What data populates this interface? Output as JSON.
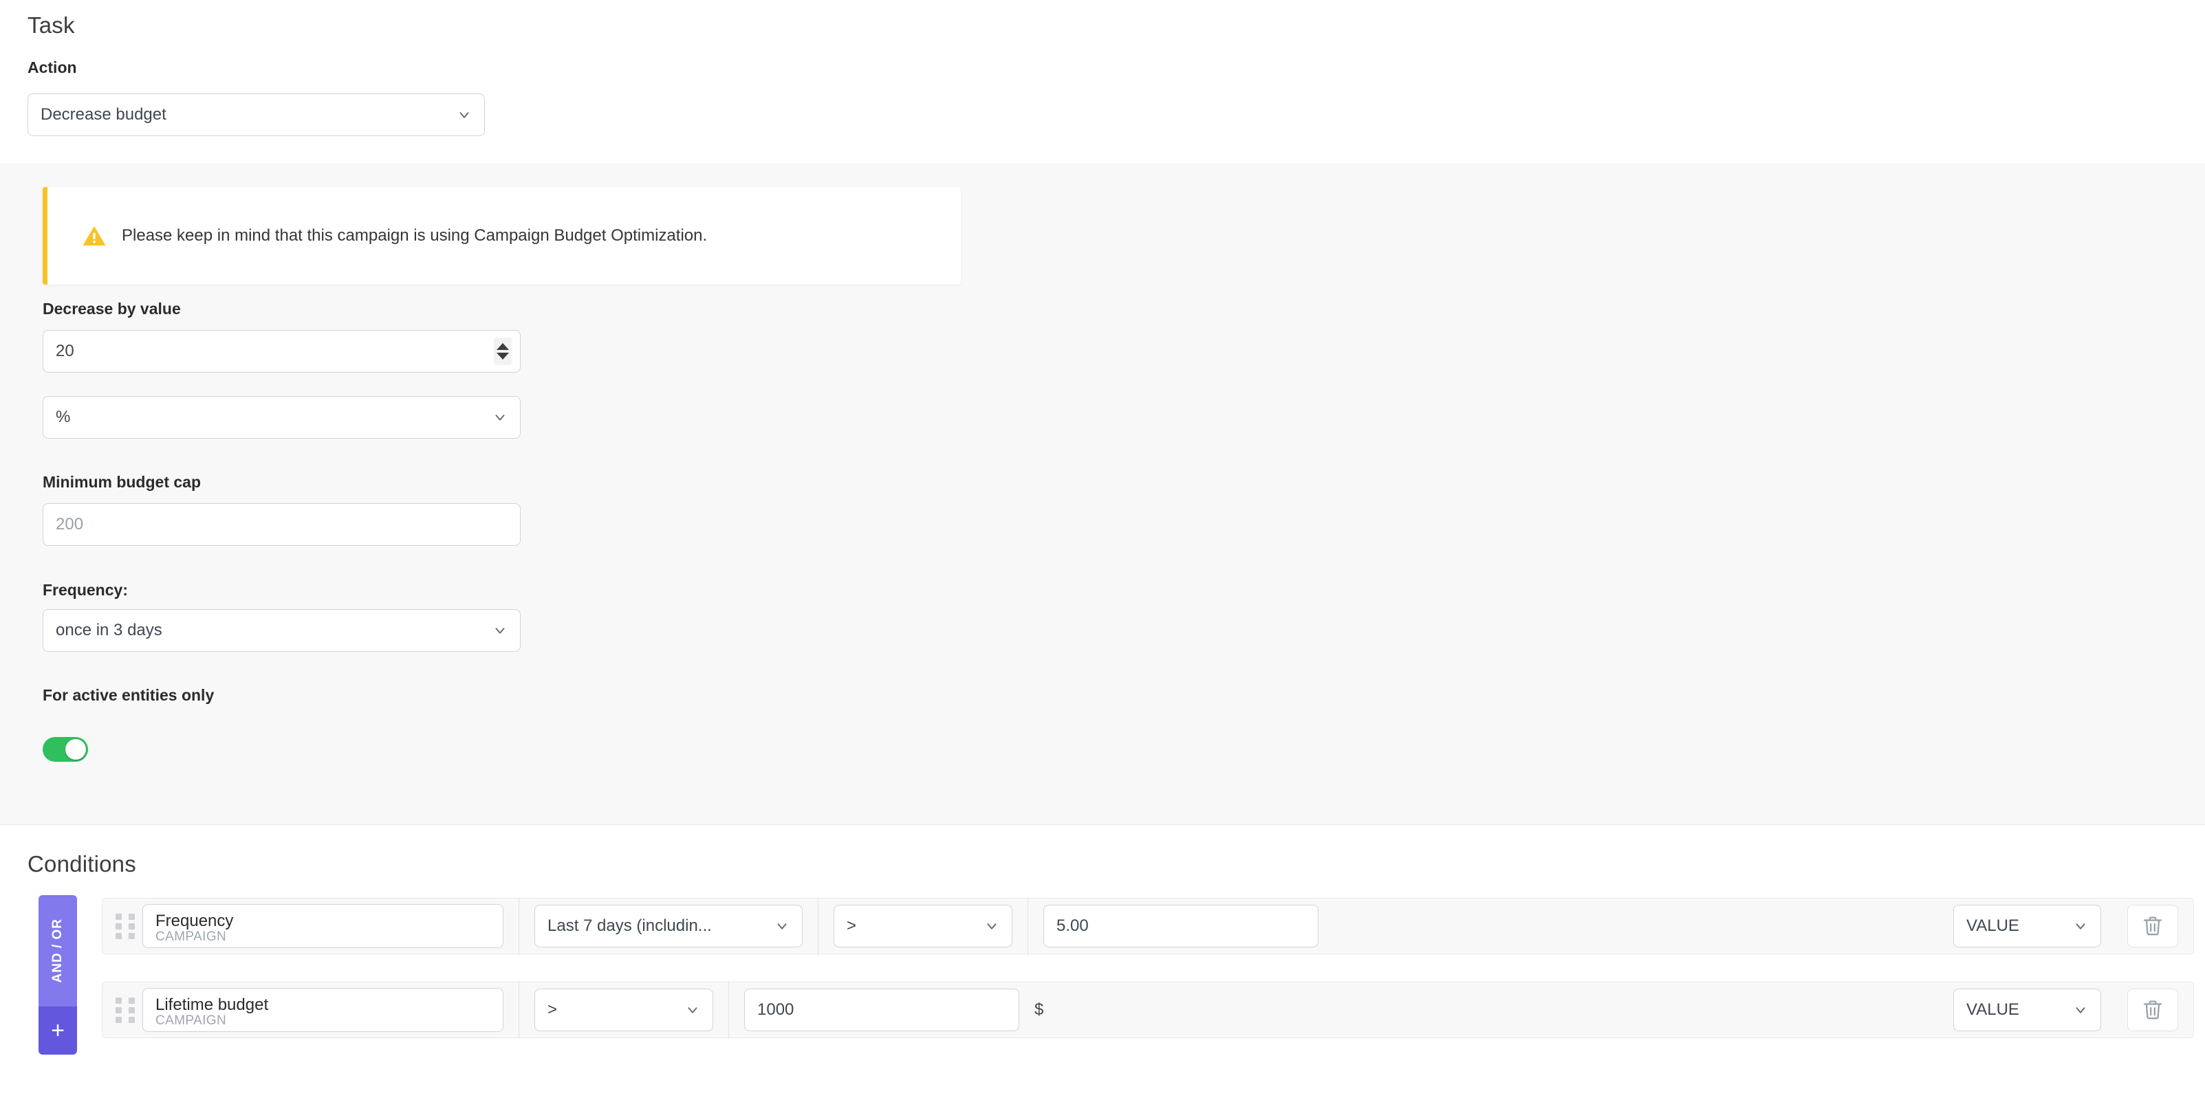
{
  "task": {
    "heading": "Task",
    "action_label": "Action",
    "action_value": "Decrease budget",
    "warning_text": "Please keep in mind that this campaign is using Campaign Budget Optimization.",
    "warning_icon": "warning-triangle-icon",
    "decrease_label": "Decrease by value",
    "decrease_value": "20",
    "unit_value": "%",
    "min_budget_label": "Minimum budget cap",
    "min_budget_value": "200",
    "frequency_label": "Frequency:",
    "frequency_value": "once in 3 days",
    "active_only_label": "For active entities only",
    "active_only_state": "on"
  },
  "conditions": {
    "heading": "Conditions",
    "rail_label": "AND / OR",
    "add_label": "+",
    "rows": [
      {
        "metric": "Frequency",
        "level": "CAMPAIGN",
        "date_range": "Last 7 days (includin...",
        "operator": ">",
        "value": "5.00",
        "unit": "",
        "value_type": "VALUE",
        "delete_icon": "trash-icon"
      },
      {
        "metric": "Lifetime budget",
        "level": "CAMPAIGN",
        "date_range": null,
        "operator": ">",
        "value": "1000",
        "unit": "$",
        "value_type": "VALUE",
        "delete_icon": "trash-icon"
      }
    ]
  },
  "colors": {
    "rail_andor": "#8179ec",
    "rail_add": "#6257dd",
    "toggle_on": "#2fbf5c",
    "warning_accent": "#f7c325",
    "panel_bg": "#f8f8f9"
  }
}
